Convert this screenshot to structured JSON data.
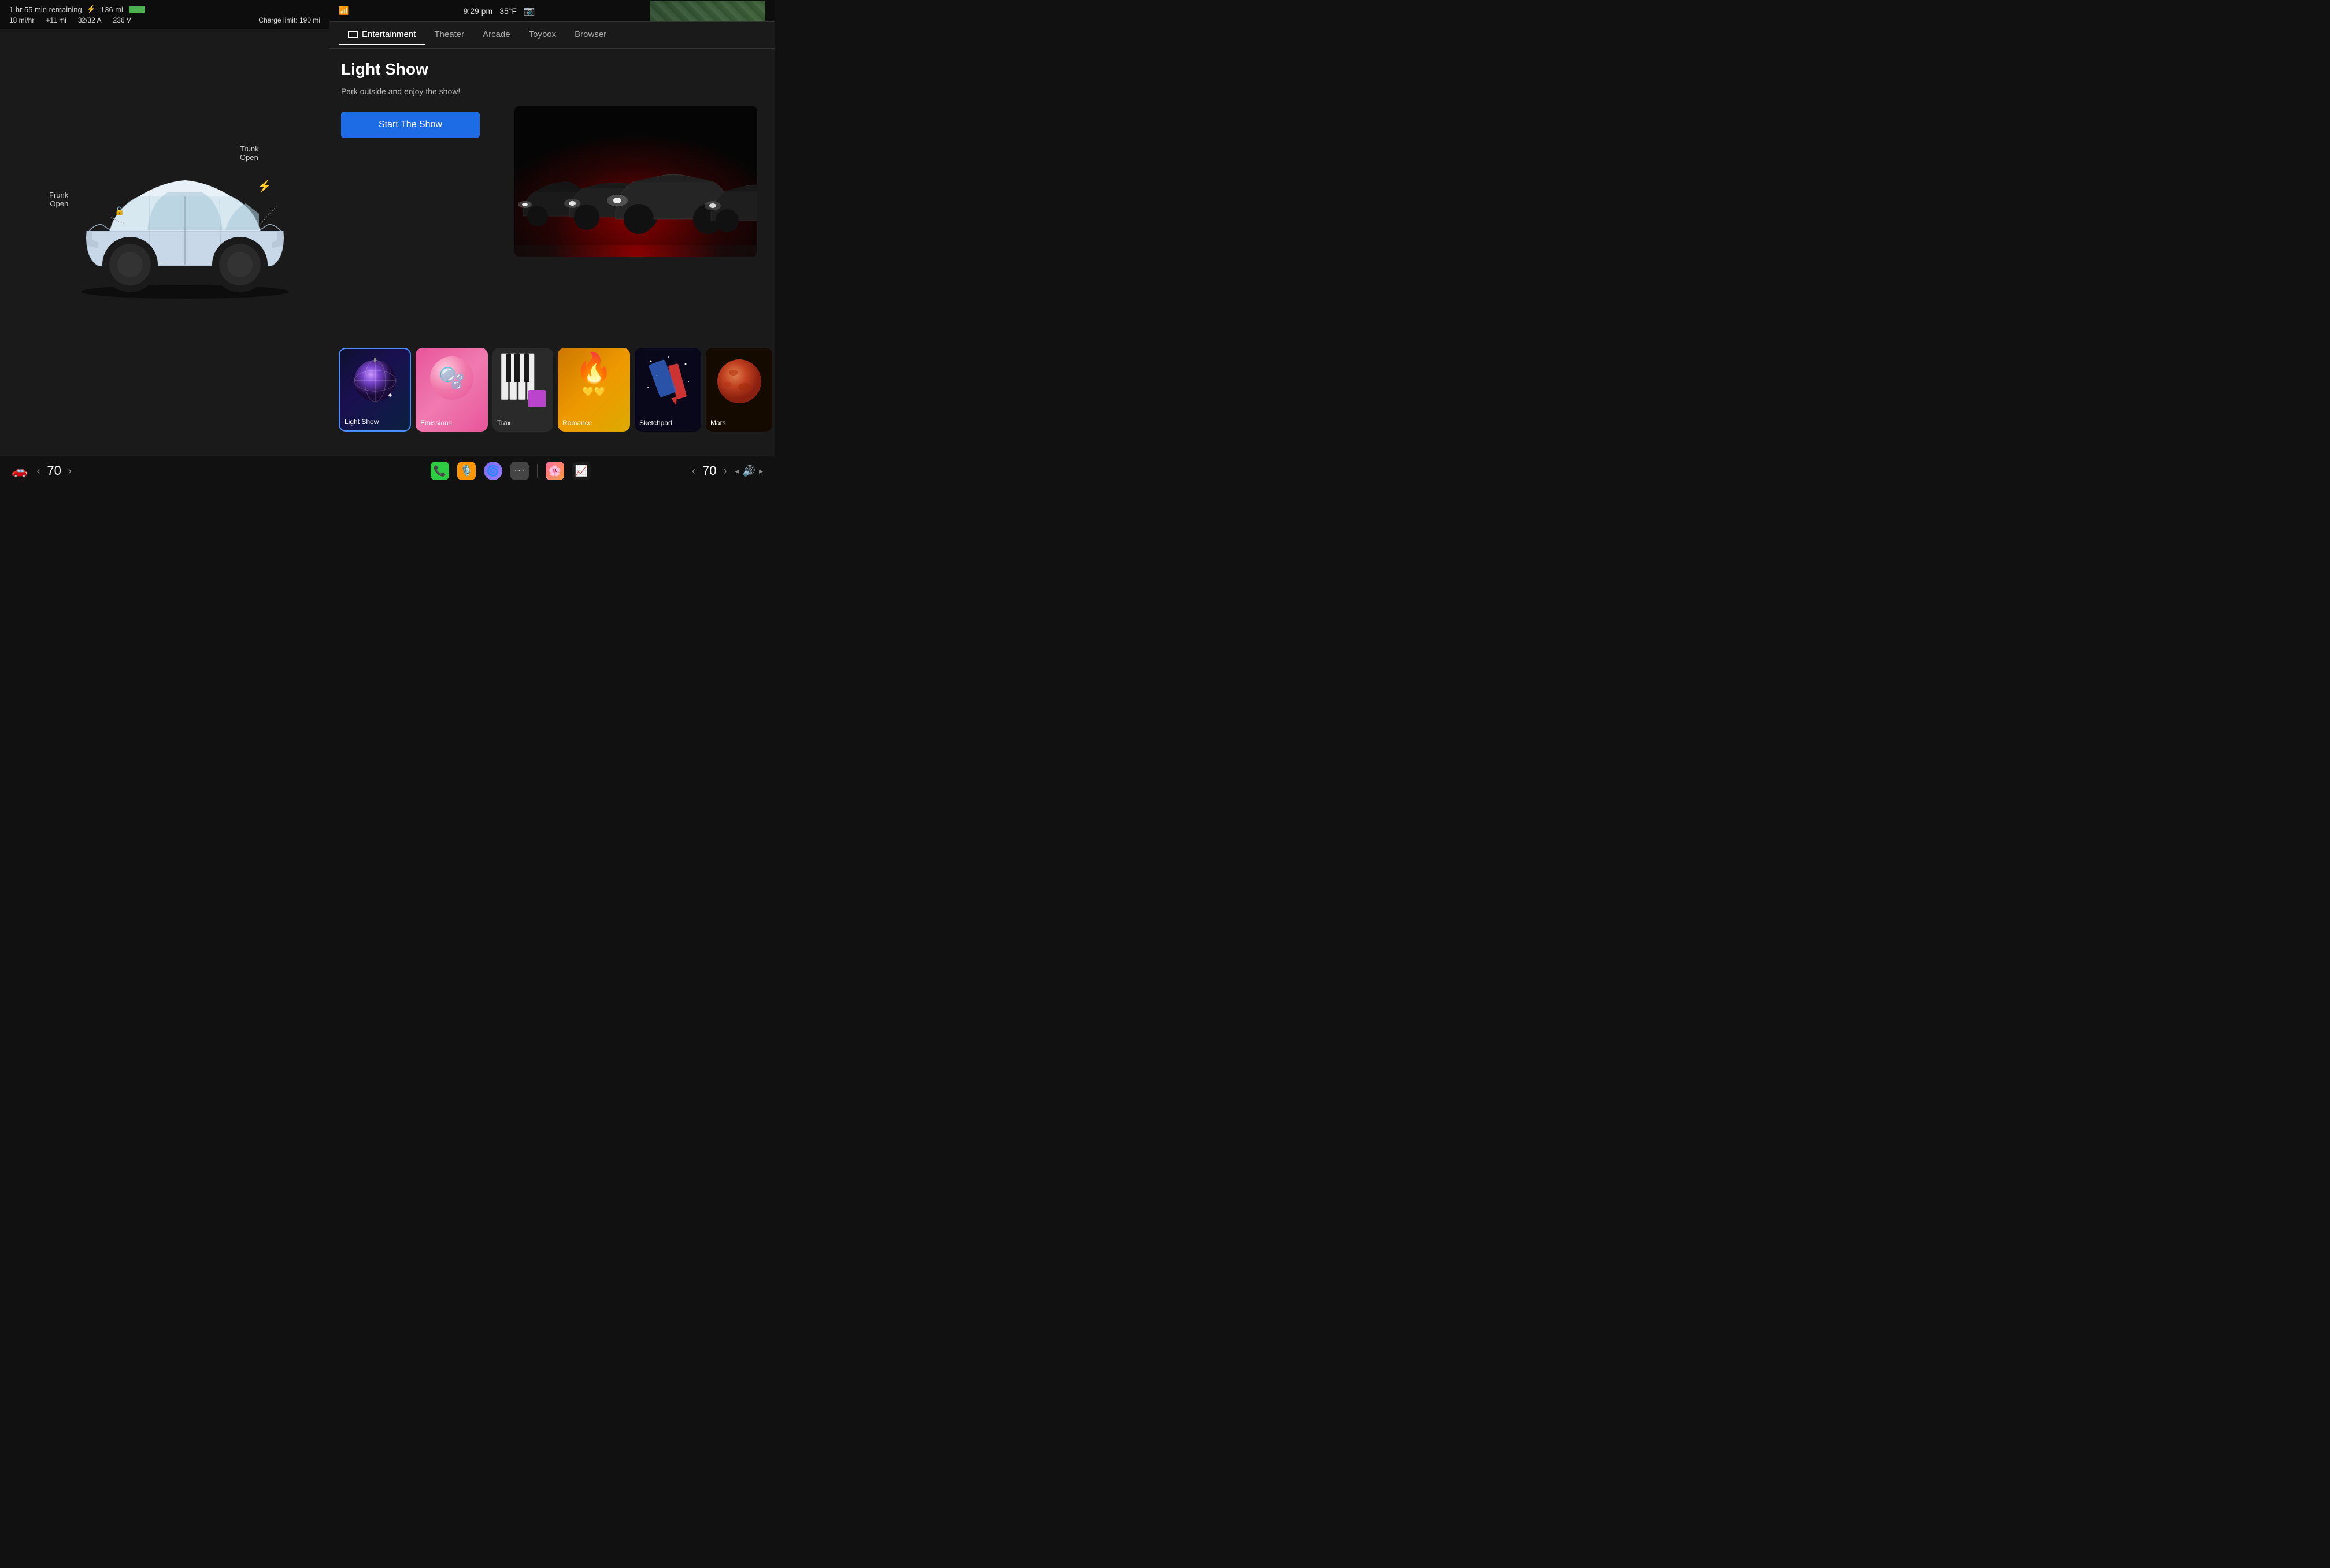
{
  "leftPanel": {
    "chargeStatus": {
      "timeRemaining": "1 hr 55 min remaining",
      "range": "136 mi",
      "stats": {
        "speed": "18 mi/hr",
        "delta": "+11 mi",
        "current": "32/32 A",
        "voltage": "236 V",
        "chargeLimit": "Charge limit: 190 mi"
      }
    },
    "carLabels": {
      "frunk": "Frunk\nOpen",
      "trunk": "Trunk\nOpen"
    },
    "speedControl": {
      "value": "70",
      "leftArrow": "‹",
      "rightArrow": "›"
    }
  },
  "rightPanel": {
    "statusBar": {
      "time": "9:29 pm",
      "temperature": "35°F"
    },
    "tabs": [
      {
        "label": "Entertainment",
        "active": true,
        "hasIcon": true
      },
      {
        "label": "Theater",
        "active": false
      },
      {
        "label": "Arcade",
        "active": false
      },
      {
        "label": "Toybox",
        "active": false
      },
      {
        "label": "Browser",
        "active": false
      }
    ],
    "lightShow": {
      "title": "Light Show",
      "description": "Park outside and enjoy the show!",
      "buttonLabel": "Start The Show"
    },
    "apps": [
      {
        "id": "light-show",
        "label": "Light Show",
        "selected": true
      },
      {
        "id": "emissions",
        "label": "Emissions",
        "selected": false
      },
      {
        "id": "trax",
        "label": "Trax",
        "selected": false
      },
      {
        "id": "romance",
        "label": "Romance",
        "selected": false
      },
      {
        "id": "sketchpad",
        "label": "Sketchpad",
        "selected": false
      },
      {
        "id": "mars",
        "label": "Mars",
        "selected": false
      }
    ],
    "speedControl": {
      "value": "70",
      "leftArrow": "‹",
      "rightArrow": "›"
    },
    "volumeIcon": "🔊"
  },
  "taskbar": {
    "icons": [
      {
        "id": "phone",
        "emoji": "📞",
        "color": "#2ecc40"
      },
      {
        "id": "podcasts",
        "emoji": "🎙️",
        "color": "#ff9500"
      },
      {
        "id": "siri",
        "emoji": "🌀",
        "color": "#7b68ee"
      },
      {
        "id": "dots",
        "emoji": "···",
        "color": "#555"
      },
      {
        "id": "photos",
        "emoji": "🌸",
        "color": "#ff6b9d"
      },
      {
        "id": "stocks",
        "emoji": "📈",
        "color": "#2ecc40"
      }
    ]
  }
}
